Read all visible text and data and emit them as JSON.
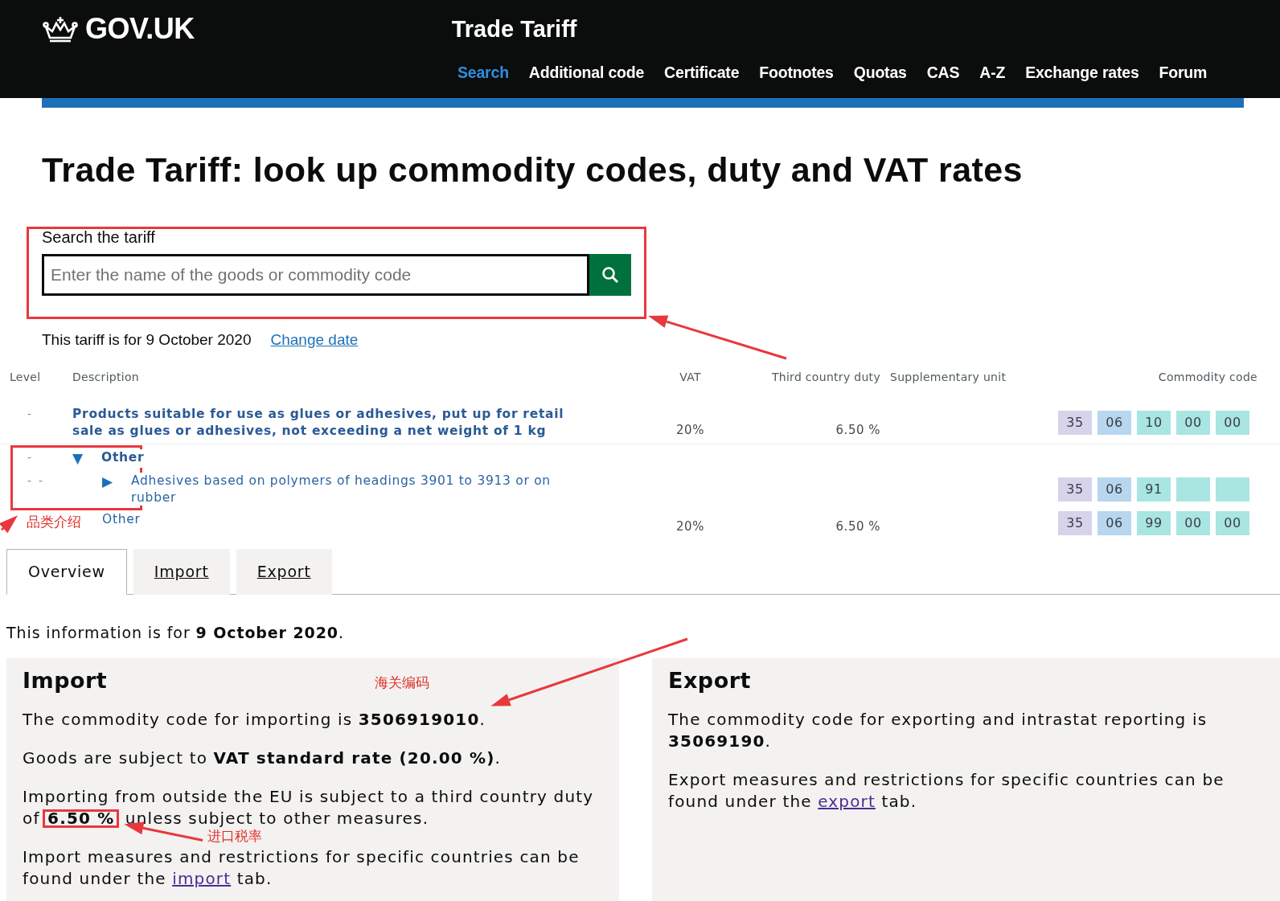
{
  "header": {
    "logo": "GOV.UK",
    "service": "Trade Tariff",
    "nav": [
      {
        "label": "Search",
        "selected": true
      },
      {
        "label": "Additional code",
        "selected": false
      },
      {
        "label": "Certificate",
        "selected": false
      },
      {
        "label": "Footnotes",
        "selected": false
      },
      {
        "label": "Quotas",
        "selected": false
      },
      {
        "label": "CAS",
        "selected": false
      },
      {
        "label": "A-Z",
        "selected": false
      },
      {
        "label": "Exchange rates",
        "selected": false
      },
      {
        "label": "Forum",
        "selected": false
      }
    ]
  },
  "title": "Trade Tariff: look up commodity codes, duty and VAT rates",
  "search": {
    "label": "Search the tariff",
    "placeholder": "Enter the name of the goods or commodity code"
  },
  "date_line": {
    "text": "This tariff is for 9 October 2020",
    "link": "Change date"
  },
  "table": {
    "columns": [
      "Level",
      "Description",
      "VAT",
      "Third country duty",
      "Supplementary unit",
      "Commodity code"
    ],
    "rows": [
      {
        "level_marks": "-",
        "kind": "heading",
        "description": "Products suitable for use as glues or adhesives, put up for retail sale as glues or adhesives, not exceeding a net weight of 1 kg",
        "vat": "20%",
        "duty": "6.50 %",
        "code": [
          "35",
          "06",
          "10",
          "00",
          "00"
        ]
      },
      {
        "level_marks": "-",
        "kind": "heading",
        "marker": "▼",
        "description": "Other",
        "children": [
          {
            "level_marks": "-  -",
            "kind": "item",
            "marker": "▶",
            "description": "Adhesives based on polymers of headings 3901 to 3913 or on rubber",
            "code": [
              "35",
              "06",
              "91"
            ]
          },
          {
            "kind": "item",
            "description": "Other",
            "vat": "20%",
            "duty": "6.50 %",
            "code": [
              "35",
              "06",
              "99",
              "00",
              "00"
            ]
          }
        ]
      }
    ]
  },
  "tabs": [
    {
      "label": "Overview",
      "selected": true
    },
    {
      "label": "Import",
      "selected": false
    },
    {
      "label": "Export",
      "selected": false
    }
  ],
  "info": "This information is for **9 October 2020**.",
  "panels": [
    {
      "title": "Import",
      "paragraphs": [
        "The commodity code for importing is **3506919010**.",
        "Goods are subject to **VAT standard rate (20.00 %)**.",
        "Importing from outside the EU is subject to a third country duty of **6.50 %** unless subject to other measures."
      ],
      "footer": {
        "before": "Import measures and restrictions for specific countries can be found under the",
        "link": "import",
        "after": "tab."
      }
    },
    {
      "title": "Export",
      "paragraphs": [
        "The commodity code for exporting and intrastat reporting is **35069190**."
      ],
      "footer": {
        "before": "Export measures and restrictions for specific countries can be found under the",
        "link": "export",
        "after": "tab."
      }
    }
  ],
  "annotations": {
    "notes": [
      "品类介绍",
      "海关编码",
      "进口税率"
    ]
  }
}
